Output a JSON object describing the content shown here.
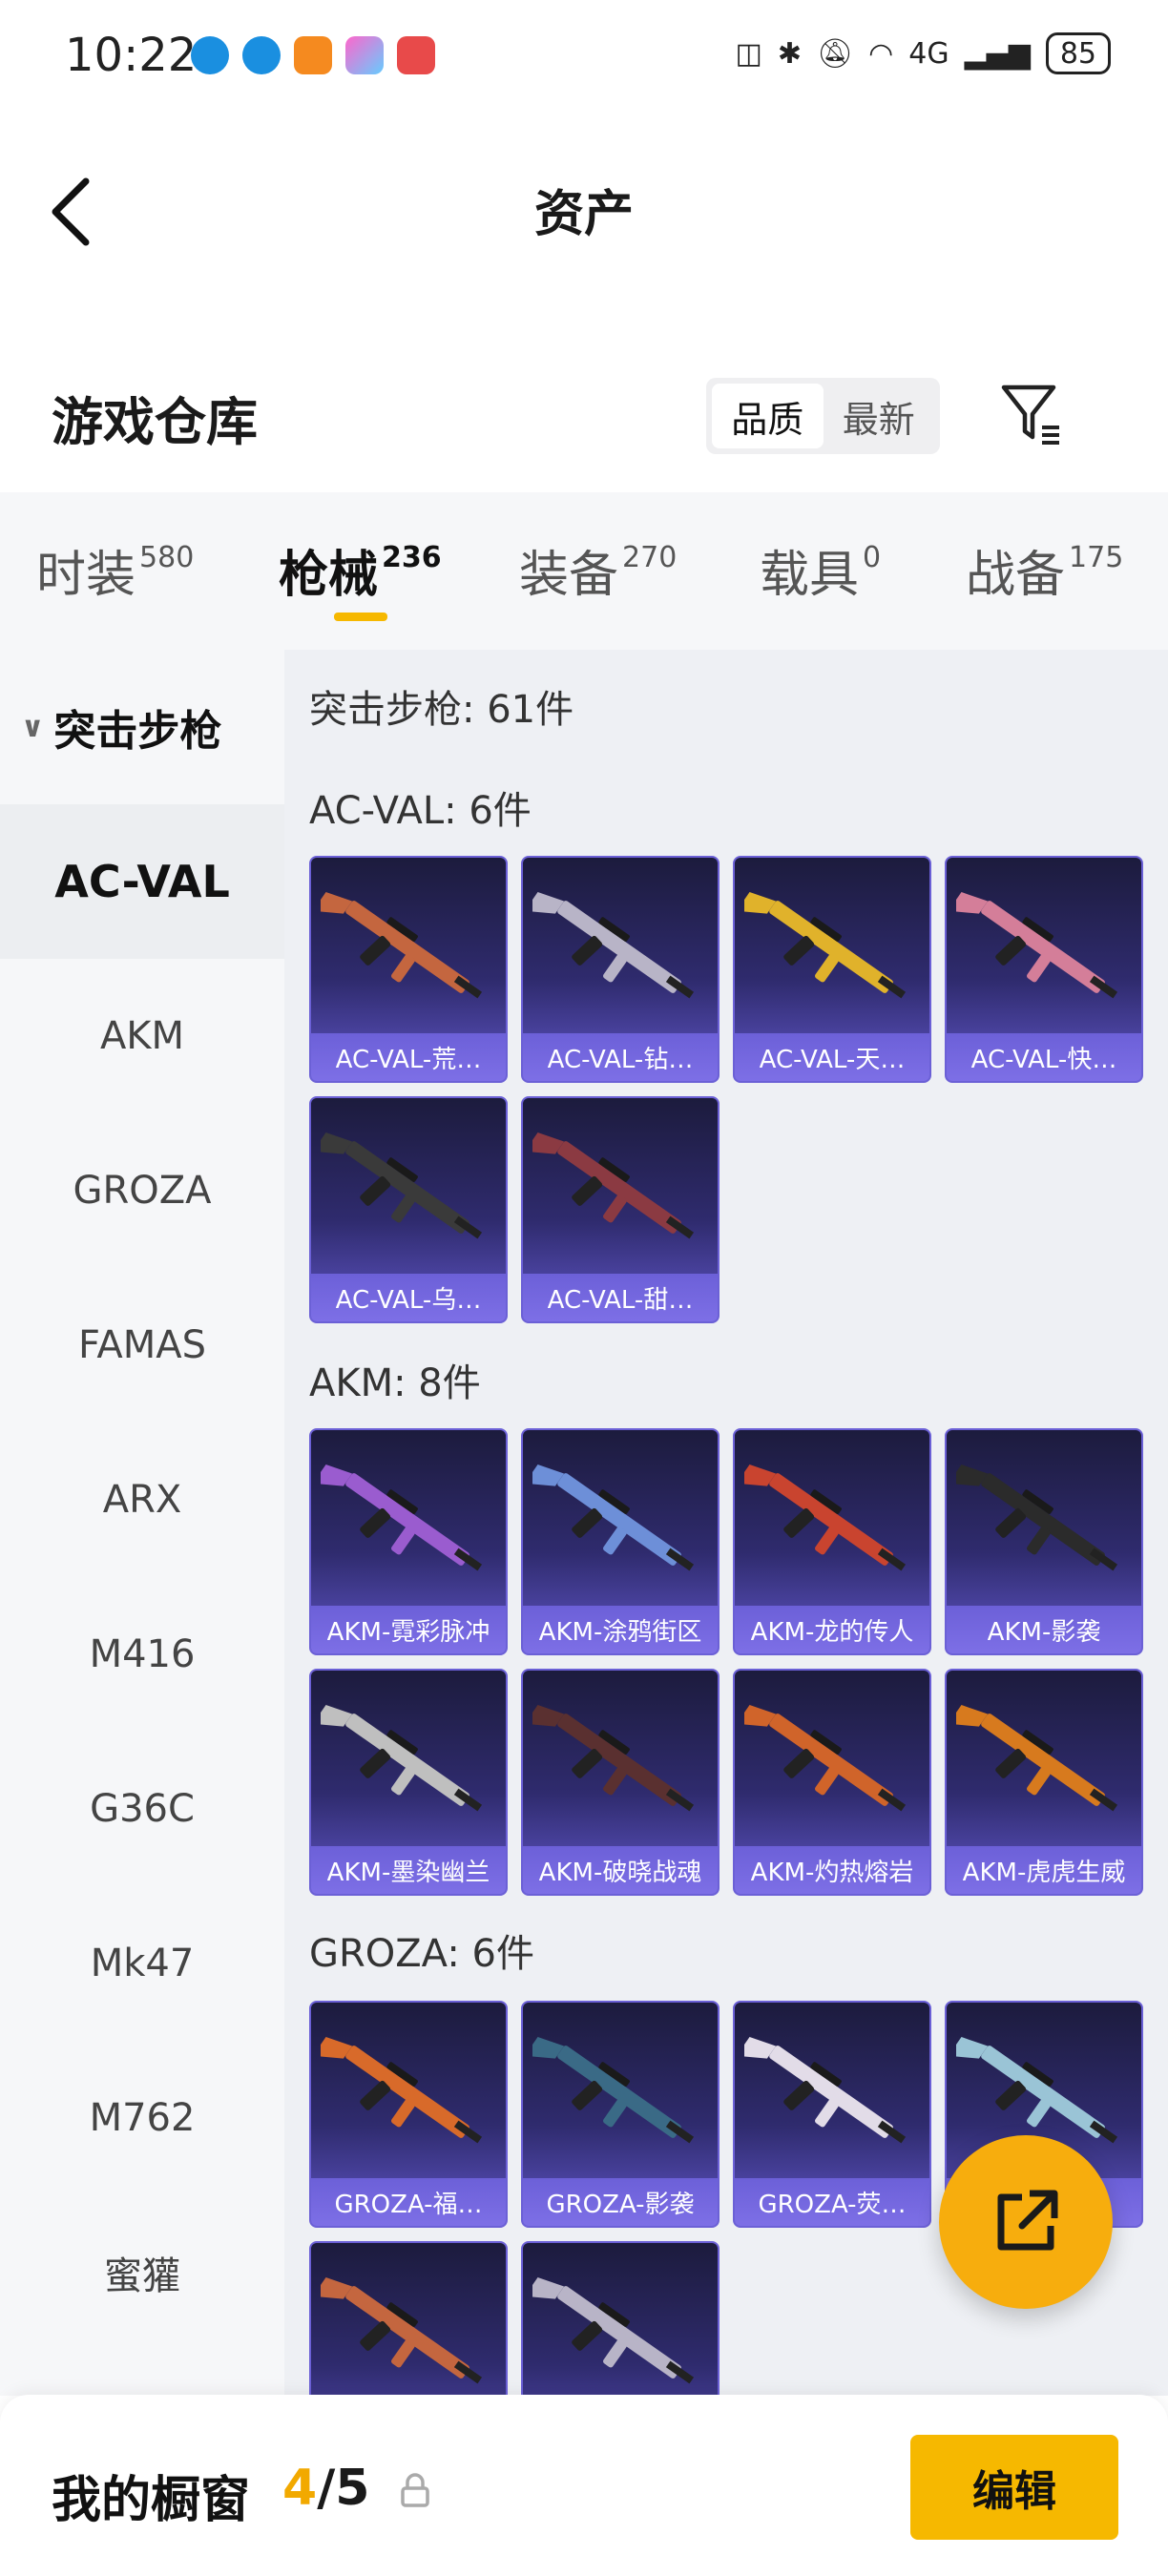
{
  "status": {
    "time": "10:22",
    "network": "4G",
    "battery": "85"
  },
  "header": {
    "title": "资产"
  },
  "warehouse": {
    "title": "游戏仓库",
    "sort_quality": "品质",
    "sort_newest": "最新"
  },
  "tabs": [
    {
      "label": "时装",
      "count": "580"
    },
    {
      "label": "枪械",
      "count": "236"
    },
    {
      "label": "装备",
      "count": "270"
    },
    {
      "label": "载具",
      "count": "0"
    },
    {
      "label": "战备",
      "count": "175"
    }
  ],
  "sidebar": {
    "group": "突击步枪",
    "items": [
      "AC-VAL",
      "AKM",
      "GROZA",
      "FAMAS",
      "ARX",
      "M416",
      "G36C",
      "Mk47",
      "M762",
      "蜜獾"
    ]
  },
  "content": {
    "category_title": "突击步枪: 61件",
    "groups": [
      {
        "title": "AC-VAL: 6件",
        "items": [
          "AC-VAL-荒…",
          "AC-VAL-钻…",
          "AC-VAL-天…",
          "AC-VAL-快…",
          "AC-VAL-乌…",
          "AC-VAL-甜…"
        ]
      },
      {
        "title": "AKM: 8件",
        "items": [
          "AKM-霓彩脉冲",
          "AKM-涂鸦街区",
          "AKM-龙的传人",
          "AKM-影袭",
          "AKM-墨染幽兰",
          "AKM-破晓战魂",
          "AKM-灼热熔岩",
          "AKM-虎虎生威"
        ]
      },
      {
        "title": "GROZA: 6件",
        "items": [
          "GROZA-福…",
          "GROZA-影袭",
          "GROZA-荧…",
          "",
          "",
          ""
        ]
      }
    ]
  },
  "bottom": {
    "my_window": "我的橱窗",
    "current": "4",
    "separator": "/",
    "max": "5",
    "edit": "编辑"
  },
  "colors": {
    "accent": "#f6b800",
    "card_label": "#7065dc",
    "card_bg": "#2f2b6e"
  }
}
